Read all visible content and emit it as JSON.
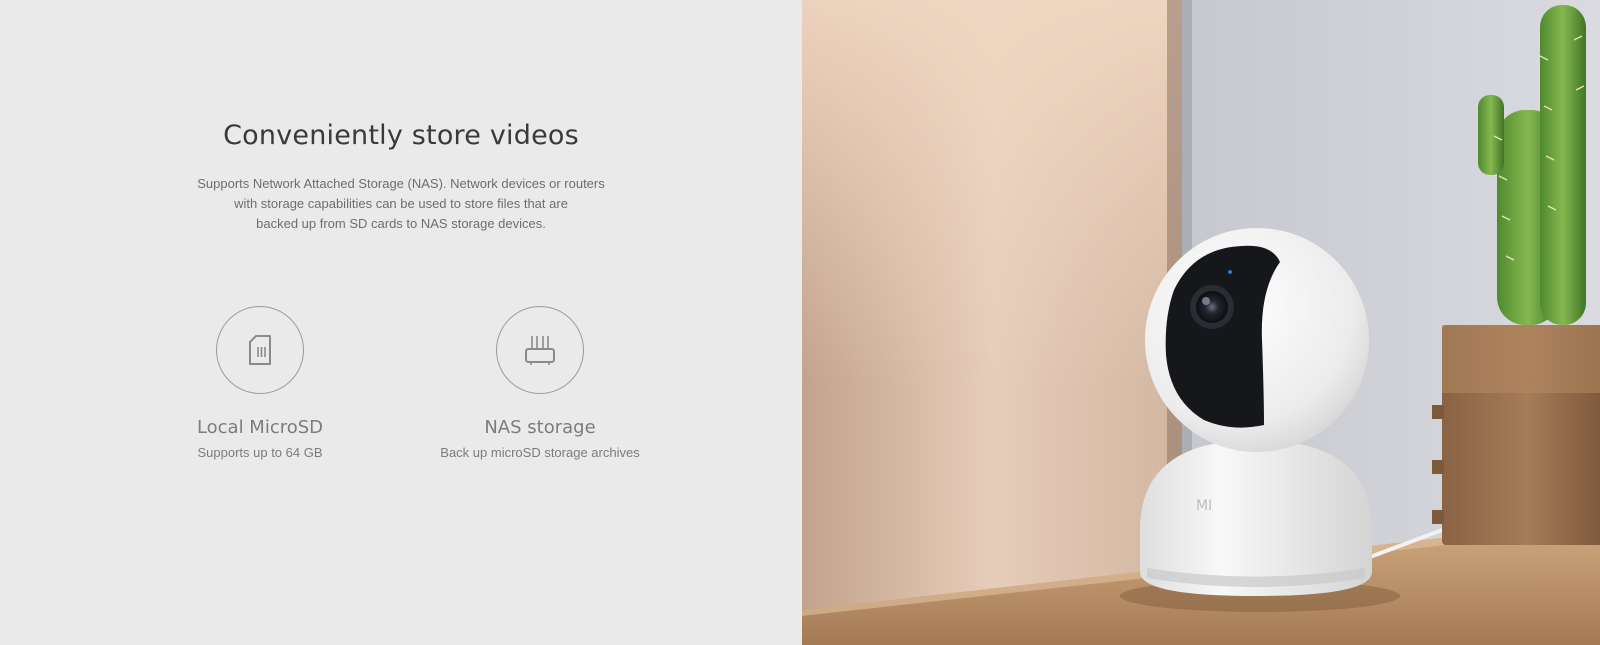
{
  "section": {
    "title": "Conveniently store videos",
    "description_lines": [
      "Supports Network Attached Storage (NAS). Network devices or routers",
      "with storage capabilities can be used to store files that are",
      "backed up from SD cards to NAS storage devices."
    ]
  },
  "features": [
    {
      "icon": "sd-card-icon",
      "title": "Local MicroSD",
      "subtitle": "Supports up to 64 GB"
    },
    {
      "icon": "router-icon",
      "title": "NAS storage",
      "subtitle": "Back up microSD storage archives"
    }
  ],
  "photo": {
    "subject": "camera-photo",
    "brand_mark": "MI"
  },
  "colors": {
    "background": "#eaeaea",
    "heading": "#3a3a3a",
    "body_text": "#6e6e6e",
    "feature_text": "#7c7c7c",
    "icon_stroke": "#9a9a9a"
  }
}
